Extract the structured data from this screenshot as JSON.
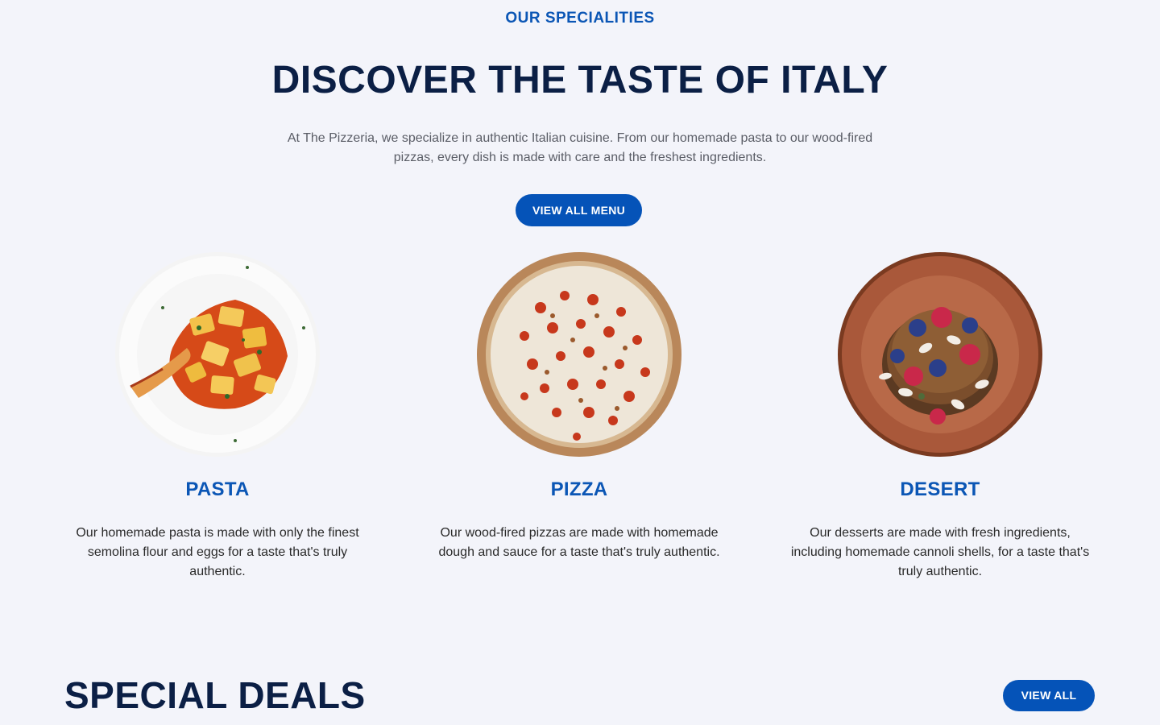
{
  "specialities": {
    "eyebrow": "OUR SPECIALITIES",
    "headline": "DISCOVER THE TASTE OF ITALY",
    "intro": "At The Pizzeria, we specialize in authentic Italian cuisine. From our homemade pasta to our wood-fired pizzas, every dish is made with care and the freshest ingredients.",
    "cta_label": "VIEW ALL MENU",
    "cards": [
      {
        "title": "PASTA",
        "description": "Our homemade pasta is made with only the finest semolina flour and eggs for a taste that's truly authentic.",
        "image": "pasta-dish-image"
      },
      {
        "title": "PIZZA",
        "description": "Our wood-fired pizzas are made with homemade dough and sauce for a taste that's truly authentic.",
        "image": "pizza-image"
      },
      {
        "title": "DESERT",
        "description": "Our desserts are made with fresh ingredients, including homemade cannoli shells, for a taste that's truly authentic.",
        "image": "dessert-plate-image"
      }
    ]
  },
  "deals": {
    "title": "SPECIAL DEALS",
    "cta_label": "VIEW ALL"
  },
  "colors": {
    "accent": "#0553b8",
    "heading": "#0b1f45",
    "background": "#f3f4fa"
  }
}
